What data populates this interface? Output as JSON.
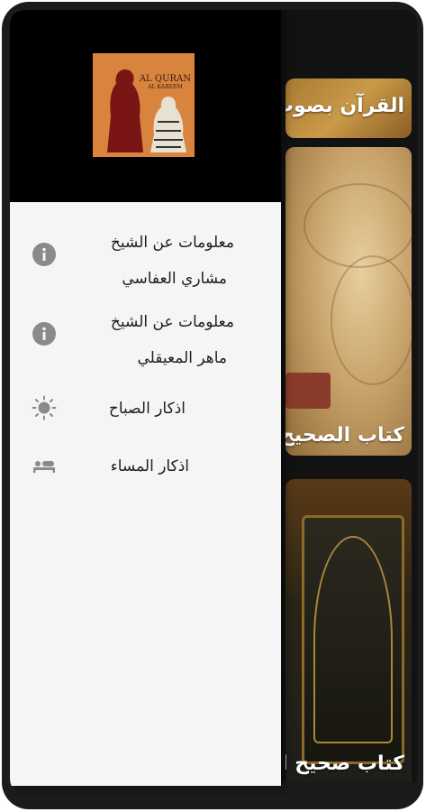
{
  "drawer": {
    "logo": {
      "text_line1": "AL QURAN",
      "text_line2": "AL KAREEM"
    },
    "items": [
      {
        "label_line1": "معلومات عن الشيخ",
        "label_line2": "مشاري العفاسي",
        "icon": "info-icon"
      },
      {
        "label_line1": "معلومات عن الشيخ",
        "label_line2": "ماهر المعيقلي",
        "icon": "info-icon"
      },
      {
        "label_line1": "اذكار الصباح",
        "icon": "sun-icon"
      },
      {
        "label_line1": "اذكار المساء",
        "icon": "bed-icon"
      }
    ]
  },
  "background": {
    "cards": [
      {
        "caption": "القرآن بصوت ا"
      },
      {
        "caption": "كتاب الصحيح م"
      },
      {
        "caption": "كتاب صحيح ال"
      }
    ]
  },
  "colors": {
    "drawer_bg": "#f5f5f5",
    "header_bg": "#000000",
    "icon_gray": "#8a8a8a",
    "logo_bg": "#d9843e"
  }
}
